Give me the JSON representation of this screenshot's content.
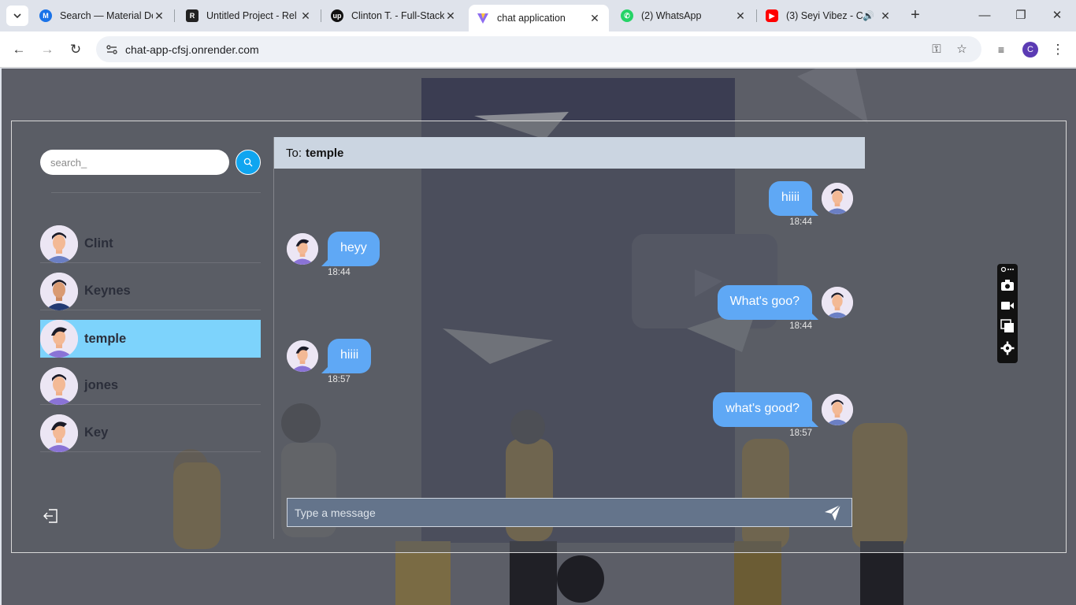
{
  "browser": {
    "tabs": [
      {
        "title": "Search — Material De",
        "favicon": "material-icon",
        "color": "#1a73e8"
      },
      {
        "title": "Untitled Project - Rel",
        "favicon": "relume-icon",
        "color": "#222222"
      },
      {
        "title": "Clinton T. - Full-Stack",
        "favicon": "upwork-icon",
        "color": "#111111"
      },
      {
        "title": "chat application",
        "favicon": "vite-icon",
        "color": "#8e6cf0",
        "active": true
      },
      {
        "title": "(2) WhatsApp",
        "favicon": "whatsapp-icon",
        "color": "#25d366"
      },
      {
        "title": "(3) Seyi Vibez - C",
        "favicon": "youtube-icon",
        "color": "#ff0000",
        "audio": true
      }
    ],
    "url": "chat-app-cfsj.onrender.com",
    "profile_initial": "C"
  },
  "sidebar": {
    "search_placeholder": "search_",
    "contacts": [
      {
        "name": "Clint"
      },
      {
        "name": "Keynes"
      },
      {
        "name": "temple",
        "selected": true
      },
      {
        "name": "jones"
      },
      {
        "name": "Key"
      }
    ]
  },
  "chat": {
    "to_label": "To:",
    "recipient": "temple",
    "messages": [
      {
        "direction": "sent",
        "text": "hiiii",
        "time": "18:44"
      },
      {
        "direction": "received",
        "text": "heyy",
        "time": "18:44"
      },
      {
        "direction": "sent",
        "text": "What's goo?",
        "time": "18:44"
      },
      {
        "direction": "received",
        "text": "hiiii",
        "time": "18:57"
      },
      {
        "direction": "sent",
        "text": "what's good?",
        "time": "18:57"
      }
    ],
    "input_placeholder": "Type a message"
  },
  "colors": {
    "accent": "#0fa5f0",
    "selected_contact": "#7dd3fc",
    "bubble": "#5fa8f5",
    "header": "#cbd5e1"
  },
  "icons": {
    "search": "search-icon",
    "logout": "logout-icon",
    "send": "send-icon",
    "float_panel": [
      "link-icon",
      "camera-icon",
      "video-icon",
      "windows-icon",
      "gear-icon"
    ]
  }
}
